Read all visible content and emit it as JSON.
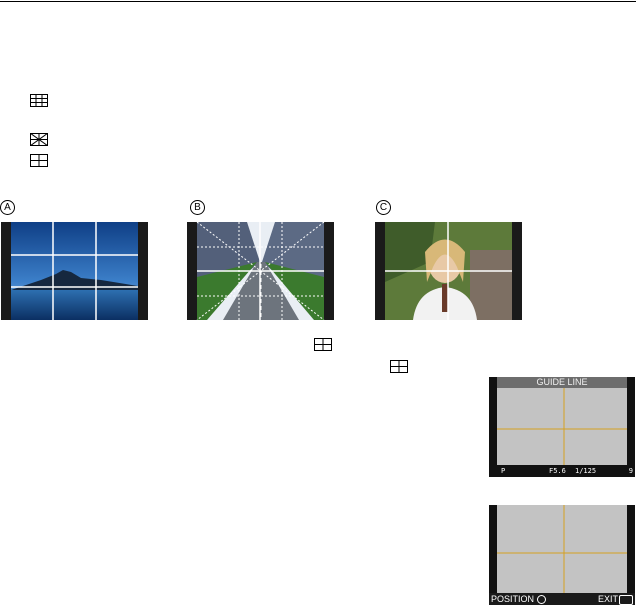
{
  "labels": {
    "a": "A",
    "b": "B",
    "c": "C"
  },
  "guide_line_screen": {
    "title": "GUIDE LINE",
    "status_left": "P",
    "status_mid": "1/125",
    "status_f": "F5.6",
    "status_count": "9"
  },
  "position_screen": {
    "position_label": "POSITION",
    "exit_label": "EXIT"
  },
  "icons": [
    "grid-3x3-icon",
    "diagonal-grid-icon",
    "cross-grid-icon"
  ],
  "colors": {
    "guide_line": "#d6a020",
    "screen_bg": "#c3c3c3",
    "title_bar": "#6d6d6d"
  }
}
